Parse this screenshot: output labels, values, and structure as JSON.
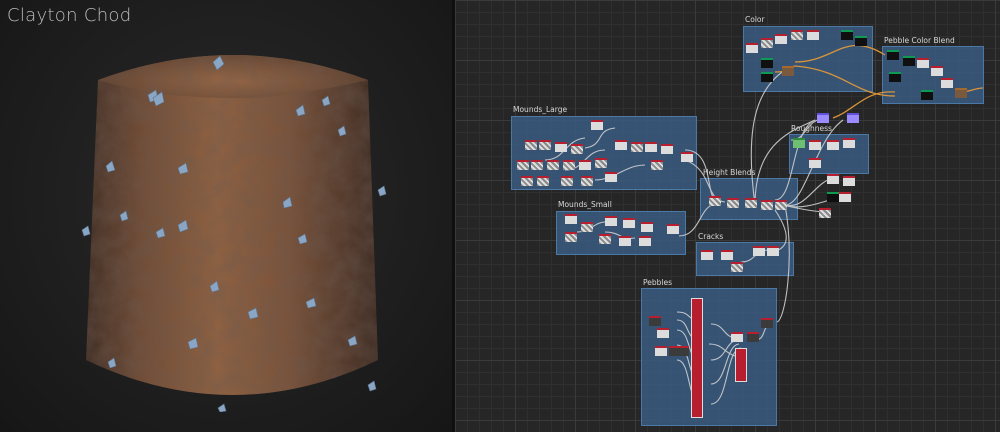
{
  "viewport": {
    "author_label": "Clayton Chod",
    "accent_colors": {
      "surface": "#8a5a3c",
      "crystal": "#7f9fbf",
      "background": "#1c1c1c"
    }
  },
  "graph": {
    "frames": {
      "color": "Color",
      "pebble_color_blend": "Pebble Color Blend",
      "mounds_large": "Mounds_Large",
      "roughness": "Roughness",
      "height_blends": "Height Blends",
      "mounds_small": "Mounds_Small",
      "cracks": "Cracks",
      "pebbles": "Pebbles"
    },
    "colors": {
      "frame": "#3a5c82",
      "node_header": "#b81f2e",
      "wire": "#d0d0d0",
      "wire_color": "#d8953a"
    }
  }
}
